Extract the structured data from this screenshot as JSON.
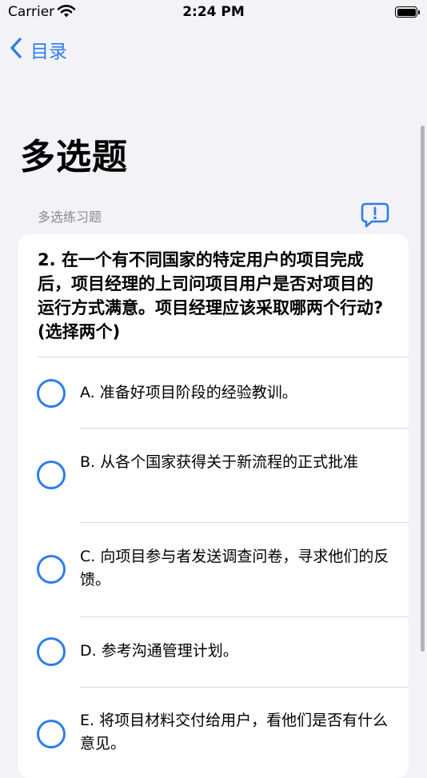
{
  "status_bar": {
    "carrier": "Carrier",
    "time": "2:24 PM"
  },
  "nav": {
    "back_label": "目录"
  },
  "page": {
    "title": "多选题",
    "section_header": "多选练习题"
  },
  "question": {
    "text": "2. 在一个有不同国家的特定用户的项目完成后，项目经理的上司问项目用户是否对项目的运行方式满意。项目经理应该采取哪两个行动?(选择两个)"
  },
  "options": [
    {
      "label": "A. 准备好项目阶段的经验教训。"
    },
    {
      "label": "B. 从各个国家获得关于新流程的正式批准"
    },
    {
      "label": "C. 向项目参与者发送调查问卷，寻求他们的反馈。"
    },
    {
      "label": "D. 参考沟通管理计划。"
    },
    {
      "label": "E. 将项目材料交付给用户，看他们是否有什么意见。"
    }
  ],
  "colors": {
    "accent": "#2f7de8",
    "background": "#f2f2f7",
    "card": "#ffffff"
  }
}
